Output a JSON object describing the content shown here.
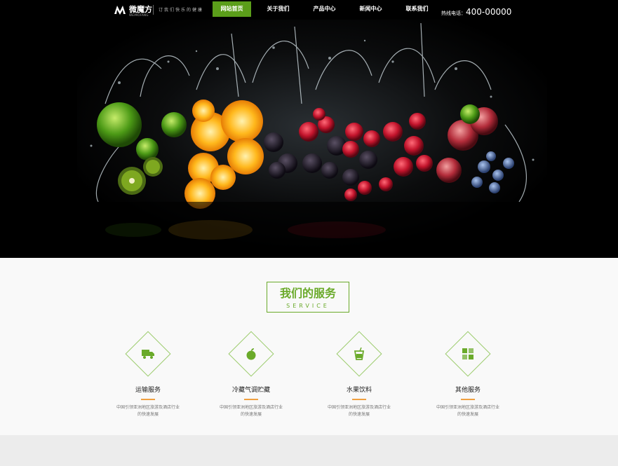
{
  "header": {
    "brand_name": "微魔方",
    "brand_sub": "WEIMOFANG",
    "slogan": "订我们快乐的健康",
    "nav": [
      {
        "label": "网站首页",
        "active": true
      },
      {
        "label": "关于我们",
        "active": false
      },
      {
        "label": "产品中心",
        "active": false
      },
      {
        "label": "新闻中心",
        "active": false
      },
      {
        "label": "联系我们",
        "active": false
      }
    ],
    "hotline_label": "热线电话：",
    "hotline_number": "400-00000"
  },
  "services": {
    "title_cn": "我们的服务",
    "title_en": "SERVICE",
    "items": [
      {
        "name": "运输服务",
        "icon": "truck-icon",
        "desc": "中国引领亚洲地区旅游及酒店行业的快速发展"
      },
      {
        "name": "冷藏气调贮藏",
        "icon": "apple-icon",
        "desc": "中国引领亚洲地区旅游及酒店行业的快速发展"
      },
      {
        "name": "水果饮料",
        "icon": "drink-cup-icon",
        "desc": "中国引领亚洲地区旅游及酒店行业的快速发展"
      },
      {
        "name": "其他服务",
        "icon": "grid-blocks-icon",
        "desc": "中国引领亚洲地区旅游及酒店行业的快速发展"
      }
    ]
  },
  "colors": {
    "accent": "#5b9e1a",
    "underline": "#f0a040",
    "header_bg": "#000000"
  }
}
